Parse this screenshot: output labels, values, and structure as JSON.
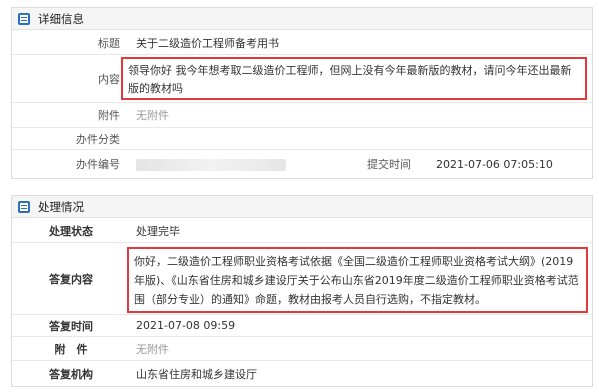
{
  "detail": {
    "header": "详细信息",
    "rows": {
      "title_label": "标题",
      "title_value": "关于二级造价工程师备考用书",
      "content_label": "内容",
      "content_value": "领导你好 我今年想考取二级造价工程师，但网上没有今年最新版的教材，请问今年还出最新版的教材吗",
      "attach_label": "附件",
      "attach_value": "无附件",
      "category_label": "办件分类",
      "category_value": "",
      "number_label": "办件编号",
      "submit_label": "提交时间",
      "submit_value": "2021-07-06 07:05:10"
    }
  },
  "handle": {
    "header": "处理情况",
    "rows": {
      "status_label": "处理状态",
      "status_value": "处理完毕",
      "reply_label": "答复内容",
      "reply_value": "你好，二级造价工程师职业资格考试依据《全国二级造价工程师职业资格考试大纲》(2019年版)、《山东省住房和城乡建设厅关于公布山东省2019年度二级造价工程师职业资格考试范围（部分专业）的通知》命题，教材由报考人员自行选购，不指定教材。",
      "time_label": "答复时间",
      "time_value": "2021-07-08 09:59",
      "attach_label": "附　件",
      "attach_value": "无附件",
      "org_label": "答复机构",
      "org_value": "山东省住房和城乡建设厅"
    }
  },
  "colors": {
    "accent": "#2a6ebd",
    "highlight_border": "#e03a3a"
  },
  "icons": {
    "detail": "list-icon",
    "handle": "list-icon"
  }
}
